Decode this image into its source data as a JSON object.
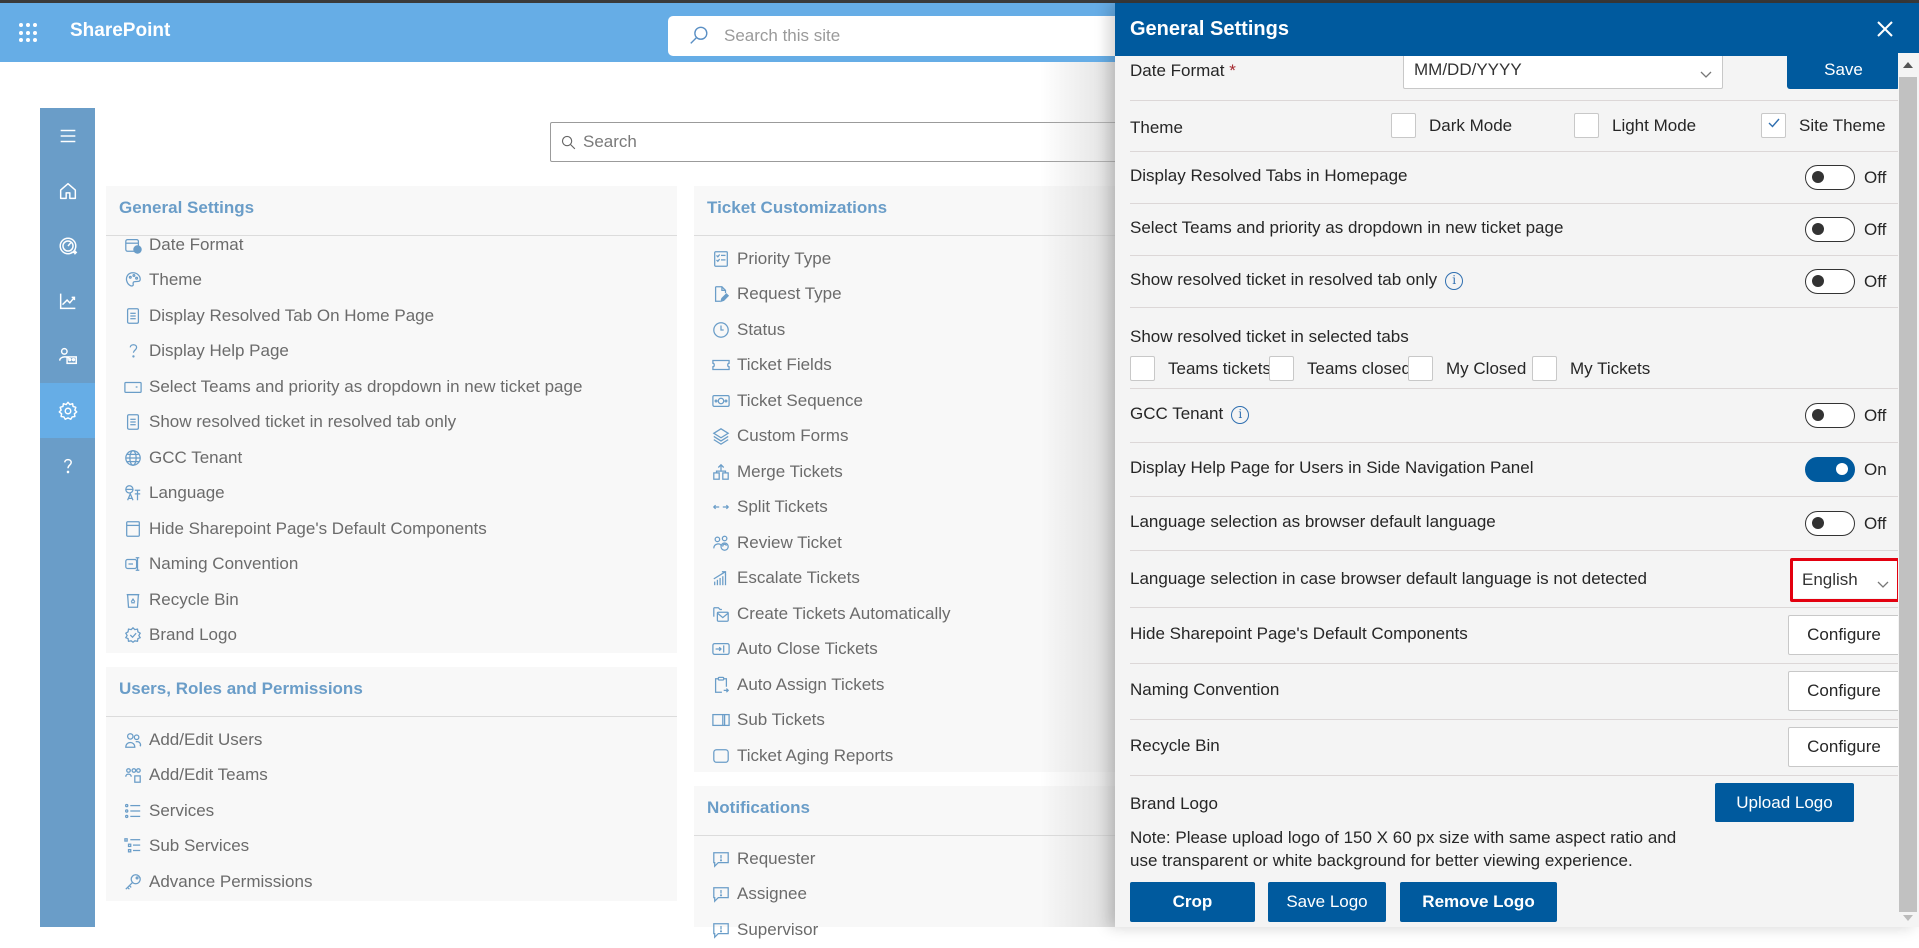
{
  "suite_bar": {
    "app_name": "SharePoint",
    "search_placeholder": "Search this site"
  },
  "nav_rail": {
    "items": [
      {
        "name": "menu",
        "icon": "hamburger-icon"
      },
      {
        "name": "home",
        "icon": "home-icon"
      },
      {
        "name": "dashboard",
        "icon": "speedometer-icon"
      },
      {
        "name": "reports",
        "icon": "chart-line-icon"
      },
      {
        "name": "teams",
        "icon": "people-team-icon"
      },
      {
        "name": "settings",
        "icon": "gear-icon",
        "active": true
      },
      {
        "name": "help",
        "icon": "question-icon"
      }
    ]
  },
  "main": {
    "search_placeholder": "Search",
    "sections": {
      "general": {
        "title": "General Settings",
        "items": [
          {
            "label": "Date Format",
            "icon": "calendar-clock-icon"
          },
          {
            "label": "Theme",
            "icon": "palette-icon"
          },
          {
            "label": "Display Resolved Tab On Home Page",
            "icon": "document-icon"
          },
          {
            "label": "Display Help Page",
            "icon": "question-icon"
          },
          {
            "label": "Select Teams and priority as dropdown in new ticket page",
            "icon": "dropdown-box-icon"
          },
          {
            "label": "Show resolved ticket in resolved tab only",
            "icon": "document-icon"
          },
          {
            "label": "GCC Tenant",
            "icon": "globe-icon"
          },
          {
            "label": "Language",
            "icon": "translate-icon"
          },
          {
            "label": "Hide Sharepoint Page's Default Components",
            "icon": "window-icon"
          },
          {
            "label": "Naming Convention",
            "icon": "rename-icon"
          },
          {
            "label": "Recycle Bin",
            "icon": "recycle-bin-icon"
          },
          {
            "label": "Brand Logo",
            "icon": "badge-check-icon"
          }
        ]
      },
      "users": {
        "title": "Users, Roles and Permissions",
        "items": [
          {
            "label": "Add/Edit Users",
            "icon": "people-icon"
          },
          {
            "label": "Add/Edit Teams",
            "icon": "people-team-icon"
          },
          {
            "label": "Services",
            "icon": "list-icon"
          },
          {
            "label": "Sub Services",
            "icon": "sub-list-icon"
          },
          {
            "label": "Advance Permissions",
            "icon": "key-icon"
          }
        ]
      },
      "tickets": {
        "title": "Ticket Customizations",
        "items": [
          {
            "label": "Priority Type",
            "icon": "task-list-icon"
          },
          {
            "label": "Request Type",
            "icon": "document-edit-icon"
          },
          {
            "label": "Status",
            "icon": "clock-icon"
          },
          {
            "label": "Ticket Fields",
            "icon": "ticket-icon"
          },
          {
            "label": "Ticket Sequence",
            "icon": "money-icon"
          },
          {
            "label": "Custom Forms",
            "icon": "layers-icon"
          },
          {
            "label": "Merge Tickets",
            "icon": "merge-icon"
          },
          {
            "label": "Split Tickets",
            "icon": "split-arrows-icon"
          },
          {
            "label": "Review Ticket",
            "icon": "people-sync-icon"
          },
          {
            "label": "Escalate Tickets",
            "icon": "chart-escalate-icon"
          },
          {
            "label": "Create Tickets Automatically",
            "icon": "mail-folder-icon"
          },
          {
            "label": "Auto Close Tickets",
            "icon": "arrow-box-icon"
          },
          {
            "label": "Auto Assign Tickets",
            "icon": "clipboard-arrow-icon"
          },
          {
            "label": "Sub Tickets",
            "icon": "split-box-icon"
          },
          {
            "label": "Ticket Aging Reports",
            "icon": "square-icon"
          }
        ]
      },
      "notifications": {
        "title": "Notifications",
        "items": [
          {
            "label": "Requester",
            "icon": "comment-alert-icon"
          },
          {
            "label": "Assignee",
            "icon": "comment-alert-icon"
          },
          {
            "label": "Supervisor",
            "icon": "comment-alert-icon"
          }
        ]
      }
    }
  },
  "panel": {
    "title": "General Settings",
    "close_label": "Close",
    "date_format": {
      "label": "Date Format",
      "required_mark": "*",
      "value": "MM/DD/YYYY",
      "save_label": "Save"
    },
    "theme": {
      "label": "Theme",
      "options": [
        {
          "label": "Dark Mode",
          "checked": false
        },
        {
          "label": "Light Mode",
          "checked": false
        },
        {
          "label": "Site Theme",
          "checked": true
        }
      ]
    },
    "toggles": [
      {
        "label": "Display Resolved Tabs in Homepage",
        "state": "Off",
        "on": false,
        "info": false
      },
      {
        "label": "Select Teams and priority as dropdown in new ticket page",
        "state": "Off",
        "on": false,
        "info": false
      },
      {
        "label": "Show resolved ticket in resolved tab only",
        "state": "Off",
        "on": false,
        "info": true
      }
    ],
    "selected_tabs": {
      "label": "Show resolved ticket in selected tabs",
      "options": [
        {
          "label": "Teams tickets",
          "checked": false
        },
        {
          "label": "Teams closed",
          "checked": false
        },
        {
          "label": "My Closed",
          "checked": false
        },
        {
          "label": "My Tickets",
          "checked": false
        }
      ]
    },
    "toggles2": [
      {
        "label": "GCC Tenant",
        "state": "Off",
        "on": false,
        "info": true
      },
      {
        "label": "Display Help Page for Users in Side Navigation Panel",
        "state": "On",
        "on": true,
        "info": false
      },
      {
        "label": "Language selection as browser default language",
        "state": "Off",
        "on": false,
        "info": false
      }
    ],
    "fallback_language": {
      "label": "Language selection in case browser default language is not detected",
      "value": "English"
    },
    "configure_rows": [
      {
        "label": "Hide Sharepoint Page's Default Components",
        "button": "Configure"
      },
      {
        "label": "Naming Convention",
        "button": "Configure"
      },
      {
        "label": "Recycle Bin",
        "button": "Configure"
      }
    ],
    "brand_logo": {
      "label": "Brand Logo",
      "upload_label": "Upload Logo",
      "note": "Note: Please upload logo of 150 X 60 px size with same aspect ratio and use transparent or white background for better viewing experience.",
      "crop_label": "Crop",
      "save_logo_label": "Save Logo",
      "remove_logo_label": "Remove Logo"
    }
  },
  "colors": {
    "suite_bar": "#66ade6",
    "panel_header": "#005a9e",
    "nav_rail": "#6a9dc8",
    "section_title": "#6a9dc8",
    "highlight": "#e3000f"
  }
}
